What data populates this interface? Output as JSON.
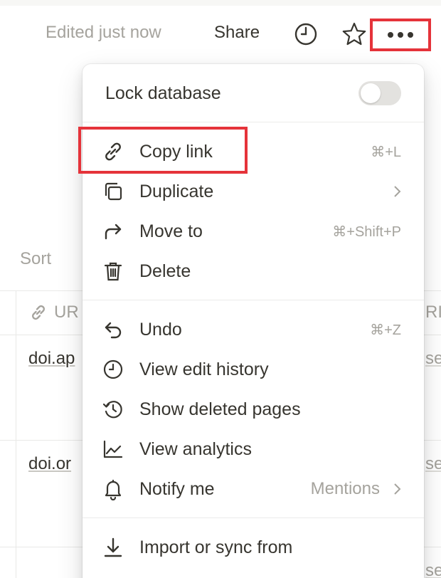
{
  "topbar": {
    "edited_text": "Edited just now",
    "share_label": "Share",
    "icons": [
      "clock-icon",
      "star-icon",
      "more-dots-icon"
    ]
  },
  "background": {
    "sort_label": "Sort",
    "url_header": "UR",
    "right_header": "RI",
    "rows": [
      {
        "url": "doi.ap",
        "right": "se"
      },
      {
        "url": "doi.or",
        "right": "se"
      },
      {
        "url": "",
        "right": "se"
      }
    ]
  },
  "menu": {
    "lock": {
      "label": "Lock database",
      "enabled": false
    },
    "group1": [
      {
        "label": "Copy link",
        "shortcut": "⌘+L",
        "icon": "link-icon"
      },
      {
        "label": "Duplicate",
        "icon": "duplicate-icon",
        "submenu": true
      },
      {
        "label": "Move to",
        "shortcut": "⌘+Shift+P",
        "icon": "move-arrow-icon"
      },
      {
        "label": "Delete",
        "icon": "trash-icon"
      }
    ],
    "group2": [
      {
        "label": "Undo",
        "shortcut": "⌘+Z",
        "icon": "undo-icon"
      },
      {
        "label": "View edit history",
        "icon": "clock-icon"
      },
      {
        "label": "Show deleted pages",
        "icon": "history-restore-icon"
      },
      {
        "label": "View analytics",
        "icon": "analytics-icon"
      },
      {
        "label": "Notify me",
        "value": "Mentions",
        "icon": "bell-icon",
        "submenu": true
      }
    ],
    "group3": [
      {
        "label": "Import or sync from",
        "icon": "import-icon"
      }
    ]
  },
  "colors": {
    "highlight": "#e5333a",
    "text": "#37352f",
    "muted": "#a5a39d"
  }
}
